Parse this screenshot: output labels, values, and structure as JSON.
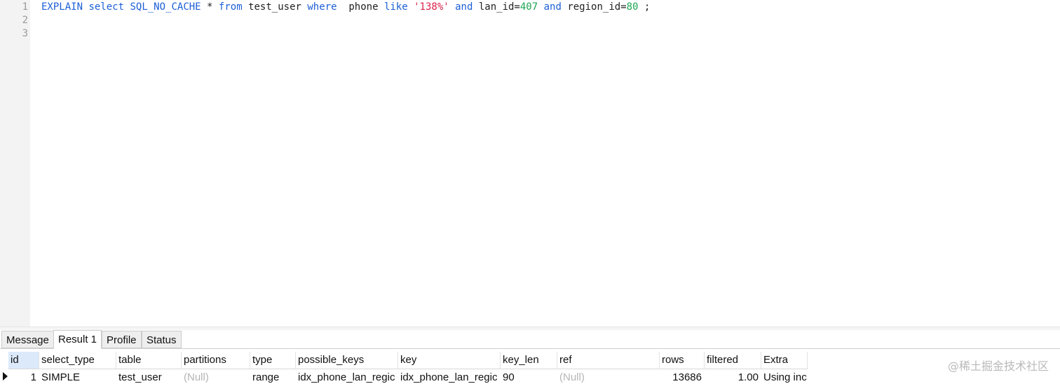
{
  "editor": {
    "line_numbers": [
      "1",
      "2",
      "3"
    ],
    "line1_tokens": [
      {
        "t": "EXPLAIN",
        "k": "kw"
      },
      {
        "t": " ",
        "k": "id"
      },
      {
        "t": "select",
        "k": "kw"
      },
      {
        "t": " ",
        "k": "id"
      },
      {
        "t": "SQL_NO_CACHE",
        "k": "kw"
      },
      {
        "t": " * ",
        "k": "id"
      },
      {
        "t": "from",
        "k": "kw"
      },
      {
        "t": " test_user ",
        "k": "id"
      },
      {
        "t": "where",
        "k": "kw"
      },
      {
        "t": "  phone ",
        "k": "id"
      },
      {
        "t": "like",
        "k": "kw"
      },
      {
        "t": " ",
        "k": "id"
      },
      {
        "t": "'138%'",
        "k": "str"
      },
      {
        "t": " ",
        "k": "id"
      },
      {
        "t": "and",
        "k": "kw"
      },
      {
        "t": " lan_id=",
        "k": "id"
      },
      {
        "t": "407",
        "k": "num"
      },
      {
        "t": " ",
        "k": "id"
      },
      {
        "t": "and",
        "k": "kw"
      },
      {
        "t": " region_id=",
        "k": "id"
      },
      {
        "t": "80",
        "k": "num"
      },
      {
        "t": " ;",
        "k": "id"
      }
    ]
  },
  "tabs": [
    {
      "label": "Message",
      "active": false
    },
    {
      "label": "Result 1",
      "active": true
    },
    {
      "label": "Profile",
      "active": false
    },
    {
      "label": "Status",
      "active": false
    }
  ],
  "grid": {
    "columns": [
      "id",
      "select_type",
      "table",
      "partitions",
      "type",
      "possible_keys",
      "key",
      "key_len",
      "ref",
      "rows",
      "filtered",
      "Extra"
    ],
    "row": [
      "1",
      "SIMPLE",
      "test_user",
      "(Null)",
      "range",
      "idx_phone_lan_regic",
      "idx_phone_lan_regic",
      "90",
      "(Null)",
      "13686",
      "1.00",
      "Using inc"
    ]
  },
  "watermark": "@稀土掘金技术社区",
  "colors": {
    "keyword": "#1c5fd6",
    "string": "#d9224b",
    "number": "#1ea653",
    "null": "#b5b5b5"
  }
}
